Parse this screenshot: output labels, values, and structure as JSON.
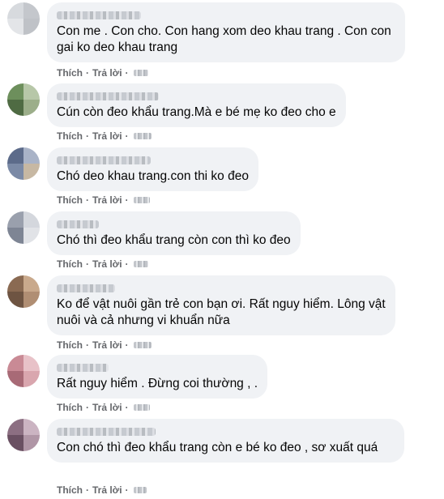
{
  "comments": [
    {
      "text": "Con me . Con cho. Con hang xom deo khau trang . Con con gai ko deo khau trang",
      "like_label": "Thích",
      "reply_label": "Trả lời",
      "avatar_colors": [
        "#d7dade",
        "#c4c7cc",
        "#e3e5e8",
        "#bfc2c7"
      ]
    },
    {
      "text": "Cún còn đeo khẩu trang.Mà e bé mẹ ko đeo cho e",
      "like_label": "Thích",
      "reply_label": "Trả lời",
      "avatar_colors": [
        "#6d8f5c",
        "#b7c7a8",
        "#4f6b43",
        "#9cae8a"
      ]
    },
    {
      "text": "Chó deo khau trang.con thi ko đeo",
      "like_label": "Thích",
      "reply_label": "Trả lời",
      "avatar_colors": [
        "#5c6b8a",
        "#a9b3c7",
        "#7b8aa6",
        "#c7b8a3"
      ]
    },
    {
      "text": "Chó thì đeo khẩu trang còn con thì ko đeo",
      "like_label": "Thích",
      "reply_label": "Trả lời",
      "avatar_colors": [
        "#9aa0ad",
        "#d4d7dd",
        "#7e8594",
        "#e1e3e7"
      ]
    },
    {
      "text": "Ko để vật nuôi gần trẻ con bạn ơi. Rất nguy hiểm. Lông vật nuôi và cả nhưng vi khuẩn nữa",
      "like_label": "Thích",
      "reply_label": "Trả lời",
      "avatar_colors": [
        "#8a6a52",
        "#c9a98c",
        "#6e5442",
        "#b08e73"
      ]
    },
    {
      "text": "Rất nguy hiểm . Đừng coi thường , .",
      "like_label": "Thích",
      "reply_label": "Trả lời",
      "avatar_colors": [
        "#c98a95",
        "#e8c2c8",
        "#a86a76",
        "#d9a6ae"
      ]
    },
    {
      "text": "Con chó thì đeo khẩu trang còn e bé ko đeo , sơ xuất quá",
      "like_label": "Thích",
      "reply_label": "Trả lời",
      "avatar_colors": [
        "#8c6f82",
        "#cbb4c2",
        "#6a5062",
        "#b096a6"
      ]
    }
  ]
}
